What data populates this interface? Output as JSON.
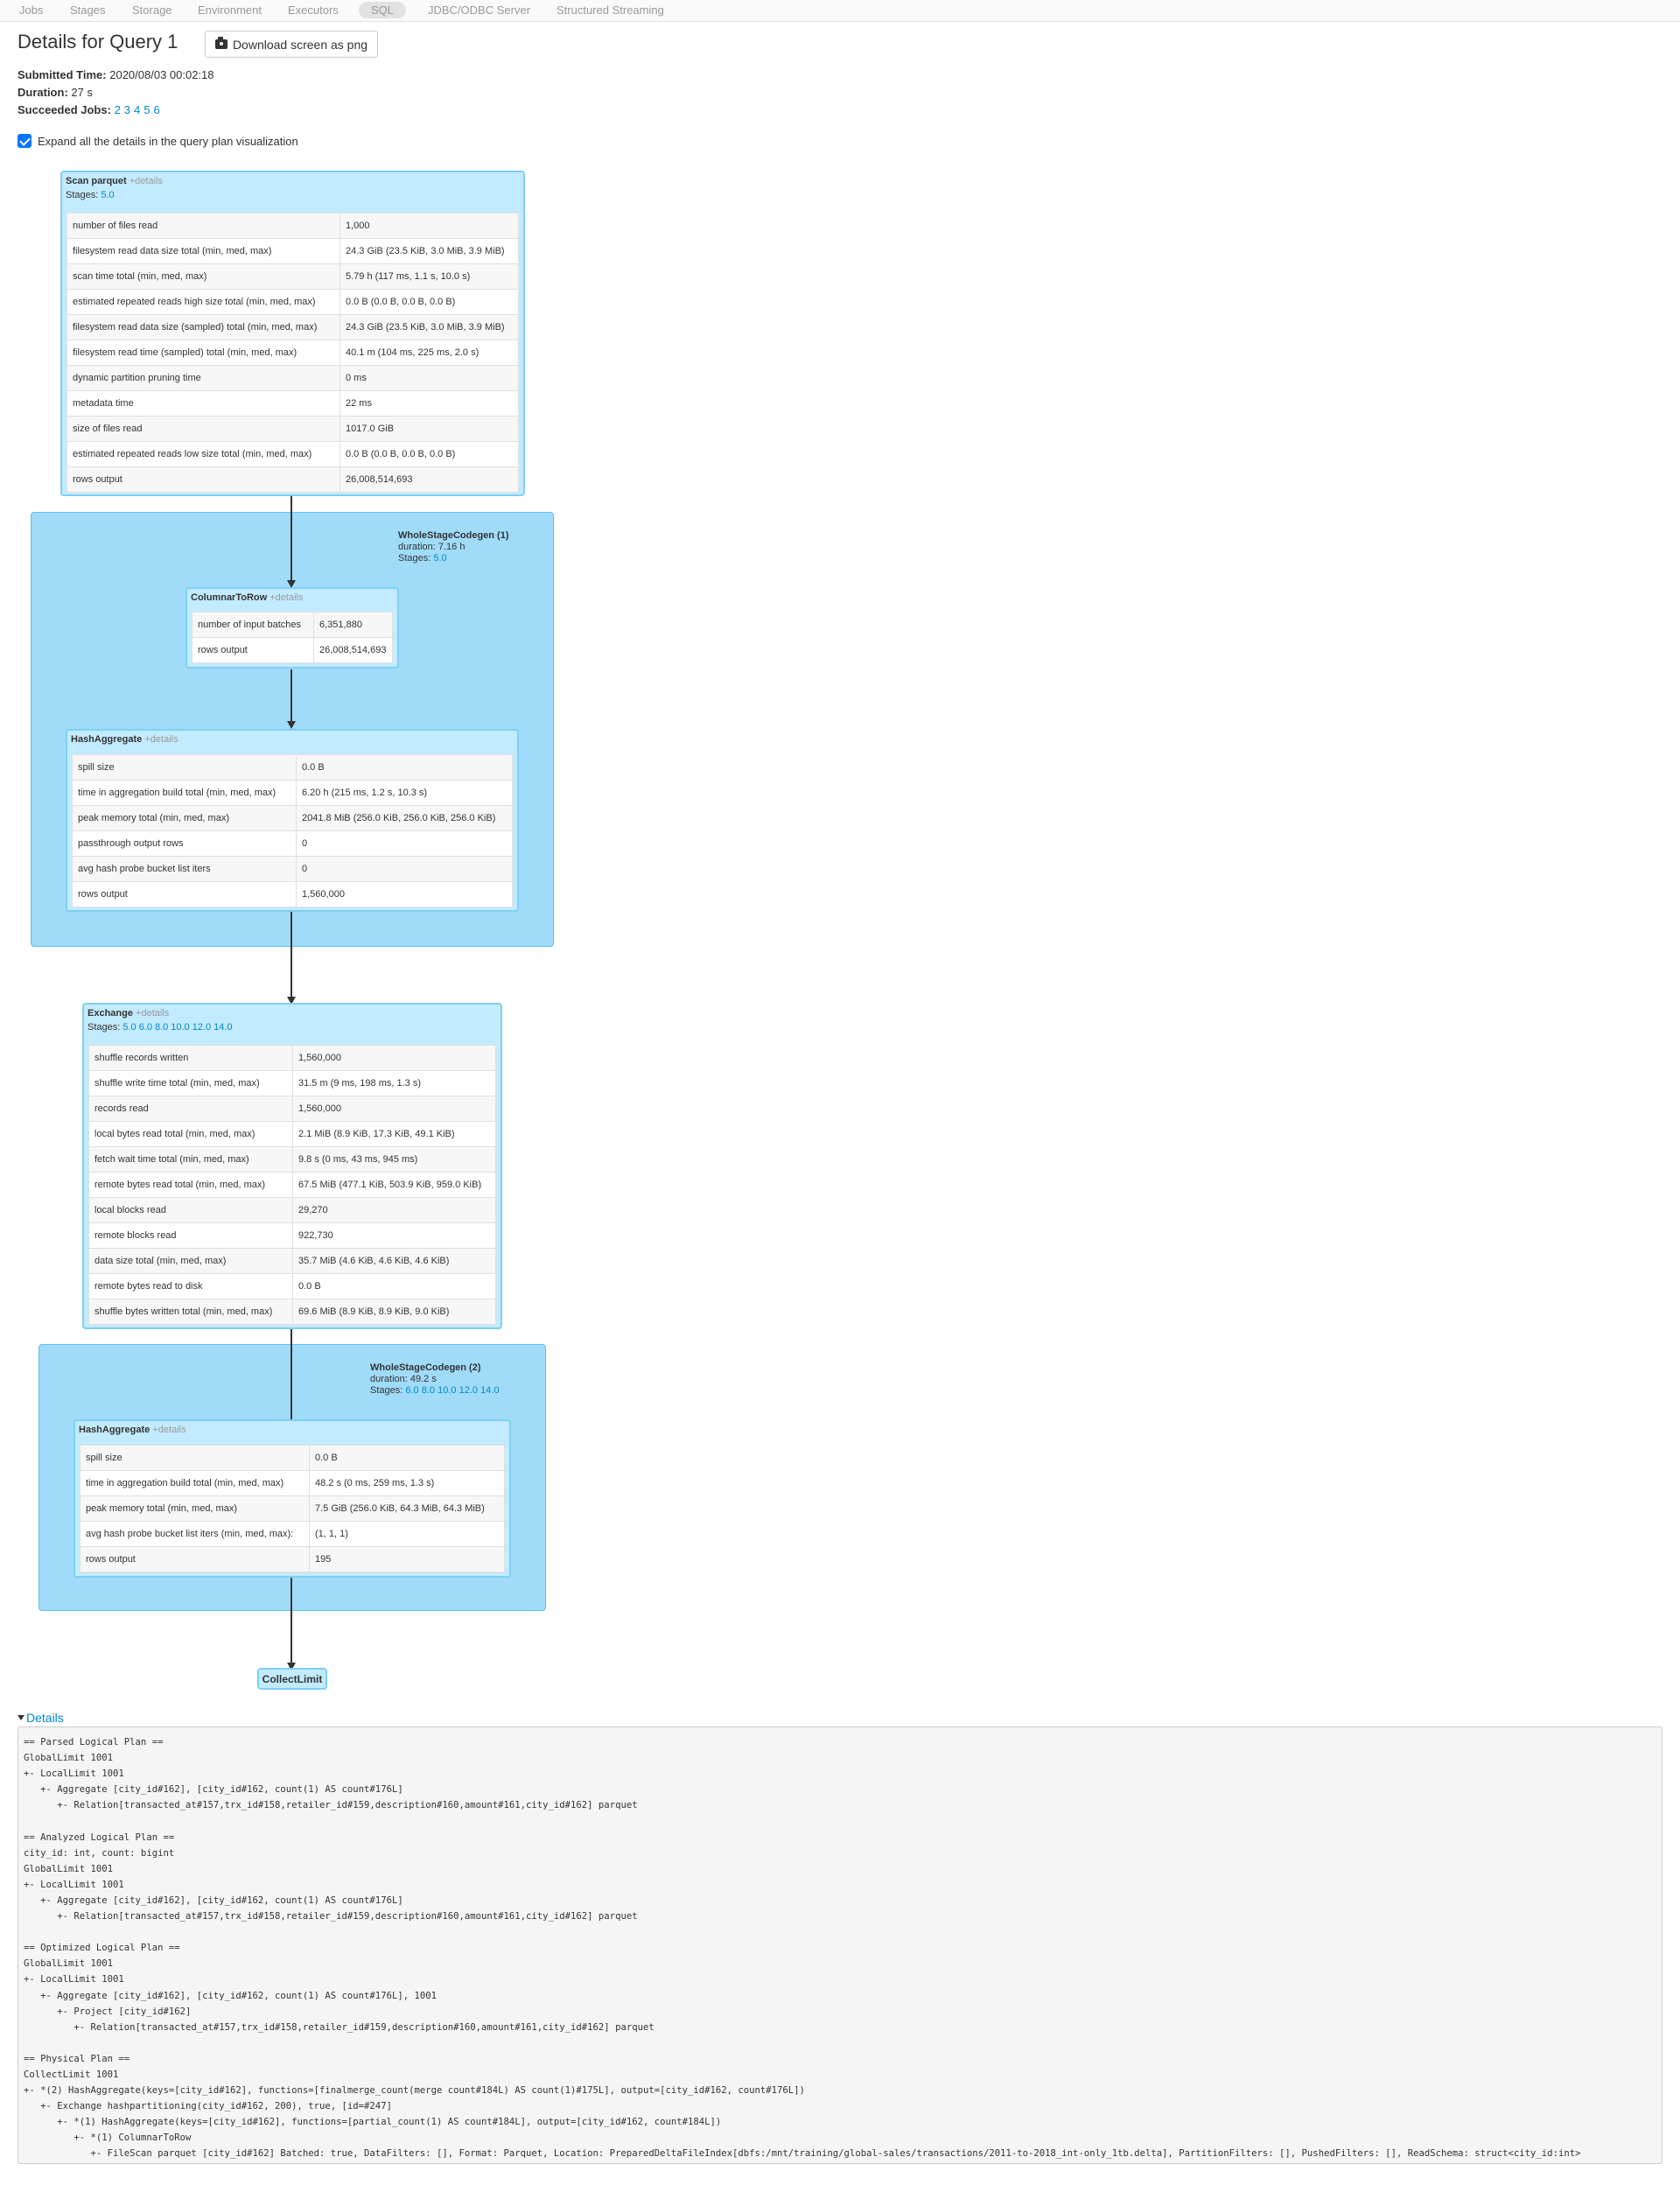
{
  "nav": {
    "items": [
      "Jobs",
      "Stages",
      "Storage",
      "Environment",
      "Executors",
      "SQL",
      "JDBC/ODBC Server",
      "Structured Streaming"
    ],
    "active": "SQL"
  },
  "header": {
    "title": "Details for Query 1",
    "download_label": "Download screen as png"
  },
  "summary": {
    "submitted_label": "Submitted Time:",
    "submitted_value": "2020/08/03 00:02:18",
    "duration_label": "Duration:",
    "duration_value": "27 s",
    "jobs_label": "Succeeded Jobs:",
    "jobs": [
      "2",
      "3",
      "4",
      "5",
      "6"
    ]
  },
  "expand": {
    "label": "Expand all the details in the query plan visualization",
    "checked": true
  },
  "plan": {
    "details_text": "+details",
    "stages_label": "Stages:",
    "duration_label": "duration:",
    "scan": {
      "title": "Scan parquet",
      "stages": [
        "5.0"
      ],
      "metrics": [
        [
          "number of files read",
          "1,000"
        ],
        [
          "filesystem read data size total (min, med, max)",
          "24.3 GiB (23.5 KiB, 3.0 MiB, 3.9 MiB)"
        ],
        [
          "scan time total (min, med, max)",
          "5.79 h (117 ms, 1.1 s, 10.0 s)"
        ],
        [
          "estimated repeated reads high size total (min, med, max)",
          "0.0 B (0.0 B, 0.0 B, 0.0 B)"
        ],
        [
          "filesystem read data size (sampled) total (min, med, max)",
          "24.3 GiB (23.5 KiB, 3.0 MiB, 3.9 MiB)"
        ],
        [
          "filesystem read time (sampled) total (min, med, max)",
          "40.1 m (104 ms, 225 ms, 2.0 s)"
        ],
        [
          "dynamic partition pruning time",
          "0 ms"
        ],
        [
          "metadata time",
          "22 ms"
        ],
        [
          "size of files read",
          "1017.0 GiB"
        ],
        [
          "estimated repeated reads low size total (min, med, max)",
          "0.0 B (0.0 B, 0.0 B, 0.0 B)"
        ],
        [
          "rows output",
          "26,008,514,693"
        ]
      ]
    },
    "wsc1": {
      "title": "WholeStageCodegen (1)",
      "duration": "7.16 h",
      "stages": [
        "5.0"
      ]
    },
    "columnar": {
      "title": "ColumnarToRow",
      "metrics": [
        [
          "number of input batches",
          "6,351,880"
        ],
        [
          "rows output",
          "26,008,514,693"
        ]
      ]
    },
    "hash1": {
      "title": "HashAggregate",
      "metrics": [
        [
          "spill size",
          "0.0 B"
        ],
        [
          "time in aggregation build total (min, med, max)",
          "6.20 h (215 ms, 1.2 s, 10.3 s)"
        ],
        [
          "peak memory total (min, med, max)",
          "2041.8 MiB (256.0 KiB, 256.0 KiB, 256.0 KiB)"
        ],
        [
          "passthrough output rows",
          "0"
        ],
        [
          "avg hash probe bucket list iters",
          "0"
        ],
        [
          "rows output",
          "1,560,000"
        ]
      ]
    },
    "exchange": {
      "title": "Exchange",
      "stages": [
        "5.0",
        "6.0",
        "8.0",
        "10.0",
        "12.0",
        "14.0"
      ],
      "metrics": [
        [
          "shuffle records written",
          "1,560,000"
        ],
        [
          "shuffle write time total (min, med, max)",
          "31.5 m (9 ms, 198 ms, 1.3 s)"
        ],
        [
          "records read",
          "1,560,000"
        ],
        [
          "local bytes read total (min, med, max)",
          "2.1 MiB (8.9 KiB, 17.3 KiB, 49.1 KiB)"
        ],
        [
          "fetch wait time total (min, med, max)",
          "9.8 s (0 ms, 43 ms, 945 ms)"
        ],
        [
          "remote bytes read total (min, med, max)",
          "67.5 MiB (477.1 KiB, 503.9 KiB, 959.0 KiB)"
        ],
        [
          "local blocks read",
          "29,270"
        ],
        [
          "remote blocks read",
          "922,730"
        ],
        [
          "data size total (min, med, max)",
          "35.7 MiB (4.6 KiB, 4.6 KiB, 4.6 KiB)"
        ],
        [
          "remote bytes read to disk",
          "0.0 B"
        ],
        [
          "shuffle bytes written total (min, med, max)",
          "69.6 MiB (8.9 KiB, 8.9 KiB, 9.0 KiB)"
        ]
      ]
    },
    "wsc2": {
      "title": "WholeStageCodegen (2)",
      "duration": "49.2 s",
      "stages": [
        "6.0",
        "8.0",
        "10.0",
        "12.0",
        "14.0"
      ]
    },
    "hash2": {
      "title": "HashAggregate",
      "metrics": [
        [
          "spill size",
          "0.0 B"
        ],
        [
          "time in aggregation build total (min, med, max)",
          "48.2 s (0 ms, 259 ms, 1.3 s)"
        ],
        [
          "peak memory total (min, med, max)",
          "7.5 GiB (256.0 KiB, 64.3 MiB, 64.3 MiB)"
        ],
        [
          "avg hash probe bucket list iters (min, med, max):",
          "(1, 1, 1)"
        ],
        [
          "rows output",
          "195"
        ]
      ]
    },
    "collect": {
      "title": "CollectLimit"
    }
  },
  "details": {
    "toggle_label": "Details",
    "text": "== Parsed Logical Plan ==\nGlobalLimit 1001\n+- LocalLimit 1001\n   +- Aggregate [city_id#162], [city_id#162, count(1) AS count#176L]\n      +- Relation[transacted_at#157,trx_id#158,retailer_id#159,description#160,amount#161,city_id#162] parquet\n\n== Analyzed Logical Plan ==\ncity_id: int, count: bigint\nGlobalLimit 1001\n+- LocalLimit 1001\n   +- Aggregate [city_id#162], [city_id#162, count(1) AS count#176L]\n      +- Relation[transacted_at#157,trx_id#158,retailer_id#159,description#160,amount#161,city_id#162] parquet\n\n== Optimized Logical Plan ==\nGlobalLimit 1001\n+- LocalLimit 1001\n   +- Aggregate [city_id#162], [city_id#162, count(1) AS count#176L], 1001\n      +- Project [city_id#162]\n         +- Relation[transacted_at#157,trx_id#158,retailer_id#159,description#160,amount#161,city_id#162] parquet\n\n== Physical Plan ==\nCollectLimit 1001\n+- *(2) HashAggregate(keys=[city_id#162], functions=[finalmerge_count(merge count#184L) AS count(1)#175L], output=[city_id#162, count#176L])\n   +- Exchange hashpartitioning(city_id#162, 200), true, [id=#247]\n      +- *(1) HashAggregate(keys=[city_id#162], functions=[partial_count(1) AS count#184L], output=[city_id#162, count#184L])\n         +- *(1) ColumnarToRow\n            +- FileScan parquet [city_id#162] Batched: true, DataFilters: [], Format: Parquet, Location: PreparedDeltaFileIndex[dbfs:/mnt/training/global-sales/transactions/2011-to-2018_int-only_1tb.delta], PartitionFilters: [], PushedFilters: [], ReadSchema: struct<city_id:int>"
  }
}
